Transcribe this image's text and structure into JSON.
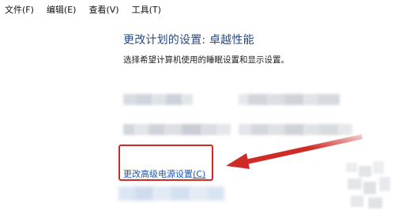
{
  "menubar": {
    "items": [
      "文件(F)",
      "编辑(E)",
      "查看(V)",
      "工具(T)"
    ]
  },
  "main": {
    "title": "更改计划的设置: 卓越性能",
    "description": "选择希望计算机使用的睡眠设置和显示设置。",
    "advanced_link_prefix": "更改高级电源设置",
    "advanced_link_shortcut": "(C)"
  },
  "annotation": {
    "highlight_color": "#d02a25",
    "arrow_color": "#d02a25"
  },
  "colors": {
    "title": "#2a4a83",
    "link": "#1b56b8"
  }
}
